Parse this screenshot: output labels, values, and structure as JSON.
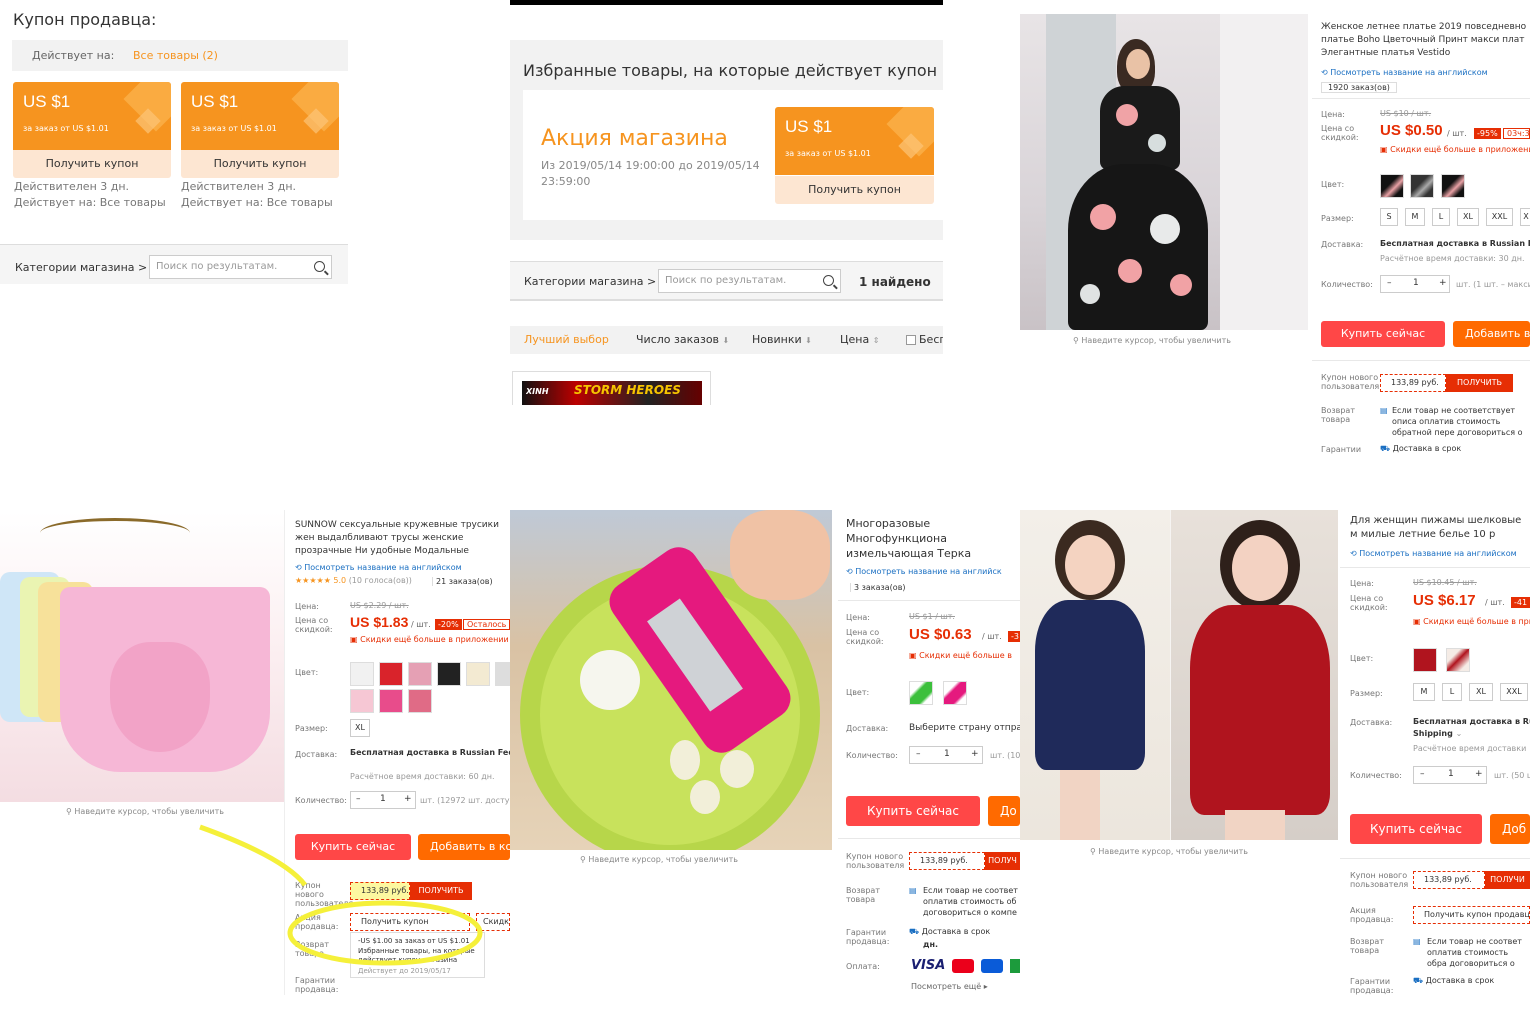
{
  "p1": {
    "title": "Купон продавца:",
    "applies_label": "Действует на:",
    "applies_value": "Все товары (2)",
    "coupons": [
      {
        "amount": "US $1",
        "cond": "за заказ от US $1.01",
        "button": "Получить купон",
        "valid": "Действителен 3 дн.",
        "applies": "Действует на: Все товары"
      },
      {
        "amount": "US $1",
        "cond": "за заказ от US $1.01",
        "button": "Получить купон",
        "valid": "Действителен 3 дн.",
        "applies": "Действует на: Все товары"
      }
    ],
    "categories": "Категории магазина >",
    "search_placeholder": "Поиск по результатам."
  },
  "p2": {
    "heading": "Избранные товары, на которые действует купон мага",
    "promo_title": "Акция магазина",
    "promo_dates": "Из 2019/05/14 19:00:00 до 2019/05/14 23:59:00",
    "coupon": {
      "amount": "US $1",
      "cond": "за заказ от US $1.01",
      "button": "Получить купон"
    },
    "categories": "Категории магазина >",
    "search_placeholder": "Поиск по результатам.",
    "found": "1 найдено",
    "sort": [
      "Лучший выбор",
      "Число заказов",
      "Новинки",
      "Цена",
      "Бесп"
    ],
    "banner": "STORM HEROES",
    "banner_brand": "XINH"
  },
  "p3": {
    "title": "Женское летнее платье 2019 повседневно платье Boho Цветочный Принт макси плат Элегантные платья Vestido",
    "translate": "Посмотреть название на английском",
    "orders": "1920 заказ(ов)",
    "price_label": "Цена:",
    "old_price": "US $10 / шт.",
    "discount_label": "Цена со скидкой:",
    "price": "US $0.50",
    "per": "/ шт.",
    "badge": "-95%",
    "timer": "03ч:3",
    "app": "Скидки ещё больше в приложени",
    "color_label": "Цвет:",
    "size_label": "Размер:",
    "sizes": [
      "S",
      "M",
      "L",
      "XL",
      "XXL",
      "X"
    ],
    "ship_label": "Доставка:",
    "ship": "Бесплатная доставка в Russian Fede",
    "ship_time": "Расчётное время доставки: 30 дн.",
    "qty_label": "Количество:",
    "qty": "1",
    "qty_note": "шт. (1 шт. – максим",
    "buy": "Купить сейчас",
    "add": "Добавить в",
    "newuser_label": "Купон нового пользователя",
    "newuser_val": "133,89 руб.",
    "newuser_btn": "ПОЛУЧИТЬ",
    "return_label": "Возврат товара",
    "return": "Если товар не соответствует описа оплатив стоимость обратной пере договориться о компенсации с пр",
    "guarantee_label": "Гарантии",
    "guarantee": "Доставка в срок",
    "zoom": "Наведите курсор, чтобы увеличить"
  },
  "p4": {
    "title": "SUNNOW сексуальные кружевные трусики жен выдалбливают трусы женские прозрачные Ни удобные Модальные промежности трусы",
    "translate": "Посмотреть название на английском",
    "rating": "5.0",
    "votes": "(10 голоса(ов))",
    "orders": "21 заказа(ов)",
    "price_label": "Цена:",
    "old_price": "US $2.29 / шт.",
    "discount_label": "Цена со скидкой:",
    "price": "US $1.83",
    "per": "/ шт.",
    "badge": "-20%",
    "left": "Осталось д",
    "app": "Скидки ещё больше в приложении",
    "color_label": "Цвет:",
    "size_label": "Размер:",
    "size": "XL",
    "ship_label": "Доставка:",
    "ship": "Бесплатная доставка в Russian Federatio",
    "ship_time": "Расчётное время доставки: 60 дн.",
    "qty_label": "Количество:",
    "qty": "1",
    "qty_note": "шт. (12972 шт. доступно)",
    "buy": "Купить сейчас",
    "add": "Добавить в кор",
    "newuser_label": "Купон нового пользователя",
    "newuser_val": "133,89 руб.",
    "newuser_btn": "ПОЛУЧИТЬ",
    "seller_label": "Акция продавца:",
    "seller_coupon": "Получить купон продавца",
    "discount_chip": "Скидка",
    "coupon_detail": "-US $1.00 за заказ от US $1.01",
    "coupon_detail2": "Избранные товары, на которые действует купон магазина",
    "valid": "Действует до 2019/05/17",
    "return_label": "Возврат товара",
    "guarantee_label": "Гарантии продавца:",
    "zoom": "Наведите курсор, чтобы увеличить"
  },
  "p5": {
    "title": "Многоразовые Многофункциона измельчающая Терка рубанок ср Инструменты Кухня аксессуары",
    "translate": "Посмотреть название на английск",
    "orders": "3 заказа(ов)",
    "price_label": "Цена:",
    "old_price": "US $1 / шт.",
    "discount_label": "Цена со скидкой:",
    "price": "US $0.63",
    "per": "/ шт.",
    "badge": "-3",
    "app": "Скидки ещё больше в",
    "color_label": "Цвет:",
    "ship_label": "Доставка:",
    "ship": "Выберите страну отправк",
    "qty_label": "Количество:",
    "qty": "1",
    "qty_note": "шт. (10",
    "buy": "Купить сейчас",
    "add": "До",
    "newuser_label": "Купон нового пользователя",
    "newuser_val": "133,89 руб.",
    "newuser_btn": "ПОЛУЧ",
    "return_label": "Возврат товара",
    "return": "Если товар не соответ оплатив стоимость об договориться о компе",
    "guarantee_label": "Гарантии продавца:",
    "guarantee": "Доставка в срок",
    "guarantee2": "дн.",
    "pay_label": "Оплата:",
    "visa": "VISA",
    "more": "Посмотреть ещё",
    "zoom": "Наведите курсор, чтобы увеличить"
  },
  "p6": {
    "title": "Для женщин пижамы шелковые м милые летние белье 10 р",
    "translate": "Посмотреть название на английском",
    "price_label": "Цена:",
    "old_price": "US $10.45 / шт.",
    "discount_label": "Цена со скидкой:",
    "price": "US $6.17",
    "per": "/ шт.",
    "badge": "-41",
    "app": "Скидки ещё больше в при",
    "color_label": "Цвет:",
    "size_label": "Размер:",
    "sizes": [
      "M",
      "L",
      "XL",
      "XXL"
    ],
    "ship_label": "Доставка:",
    "ship": "Бесплатная доставка в Ru",
    "ship2": "Shipping",
    "ship_time": "Расчётное время доставки",
    "qty_label": "Количество:",
    "qty": "1",
    "qty_note": "шт. (50 ш",
    "buy": "Купить сейчас",
    "add": "Доб",
    "newuser_label": "Купон нового пользователя",
    "newuser_val": "133,89 руб.",
    "newuser_btn": "ПОЛУЧИ",
    "seller_label": "Акция продавца:",
    "seller_coupon": "Получить купон продавц",
    "return_label": "Возврат товара",
    "return": "Если товар не соответ оплатив стоимость обра договориться о компен",
    "guarantee_label": "Гарантии продавца:",
    "guarantee": "Доставка в срок",
    "zoom": "Наведите курсор, чтобы увеличить"
  },
  "colors": {
    "orange": "#f6941f",
    "red": "#e62e04",
    "buy": "#ff4747",
    "add": "#ff6a00",
    "link": "#1a6fc2",
    "highlight": "#f5f03a"
  }
}
